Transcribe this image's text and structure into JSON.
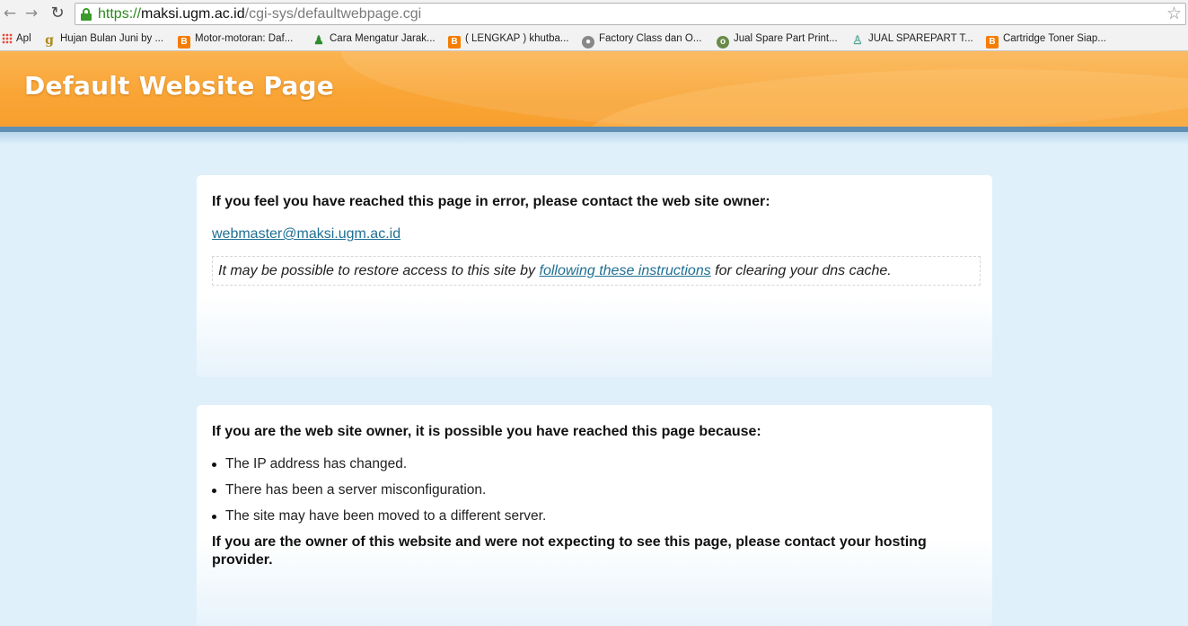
{
  "browser": {
    "url_scheme": "https://",
    "url_host": "maksi.ugm.ac.id",
    "url_path": "/cgi-sys/defaultwebpage.cgi",
    "back_icon": "back-arrow-icon",
    "forward_icon": "forward-arrow-icon",
    "reload_icon": "reload-icon",
    "star_icon": "star-icon",
    "bookmarks": [
      {
        "label": "Apl",
        "icon": "apps-grid-icon"
      },
      {
        "label": "Hujan Bulan Juni by ...",
        "icon": "g-icon"
      },
      {
        "label": "Motor-motoran: Daf...",
        "icon": "blogger-icon"
      },
      {
        "label": "Cara Mengatur Jarak...",
        "icon": "green-figure-icon"
      },
      {
        "label": "( LENGKAP ) khutba...",
        "icon": "blogger-icon"
      },
      {
        "label": "Factory Class dan O...",
        "icon": "round-icon"
      },
      {
        "label": "Jual Spare Part Print...",
        "icon": "owl-icon"
      },
      {
        "label": "JUAL SPAREPART T...",
        "icon": "figure-icon"
      },
      {
        "label": "Cartridge Toner Siap...",
        "icon": "blogger-icon"
      }
    ]
  },
  "page": {
    "title": "Default Website Page",
    "error_box": {
      "heading": "If you feel you have reached this page in error, please contact the web site owner:",
      "email": "webmaster@maksi.ugm.ac.id",
      "dns_prefix": "It may be possible to restore access to this site by ",
      "dns_link": "following these instructions",
      "dns_suffix": " for clearing your dns cache."
    },
    "owner_box": {
      "heading": "If you are the web site owner, it is possible you have reached this page because:",
      "reasons": [
        "The IP address has changed.",
        "There has been a server misconfiguration.",
        "The site may have been moved to a different server."
      ],
      "closing": "If you are the owner of this website and were not expecting to see this page, please contact your hosting provider."
    }
  },
  "colors": {
    "header_orange": "#f9a535",
    "header_bar": "#5f8fb3",
    "page_bg": "#dff0fb",
    "link": "#1f6f93"
  }
}
